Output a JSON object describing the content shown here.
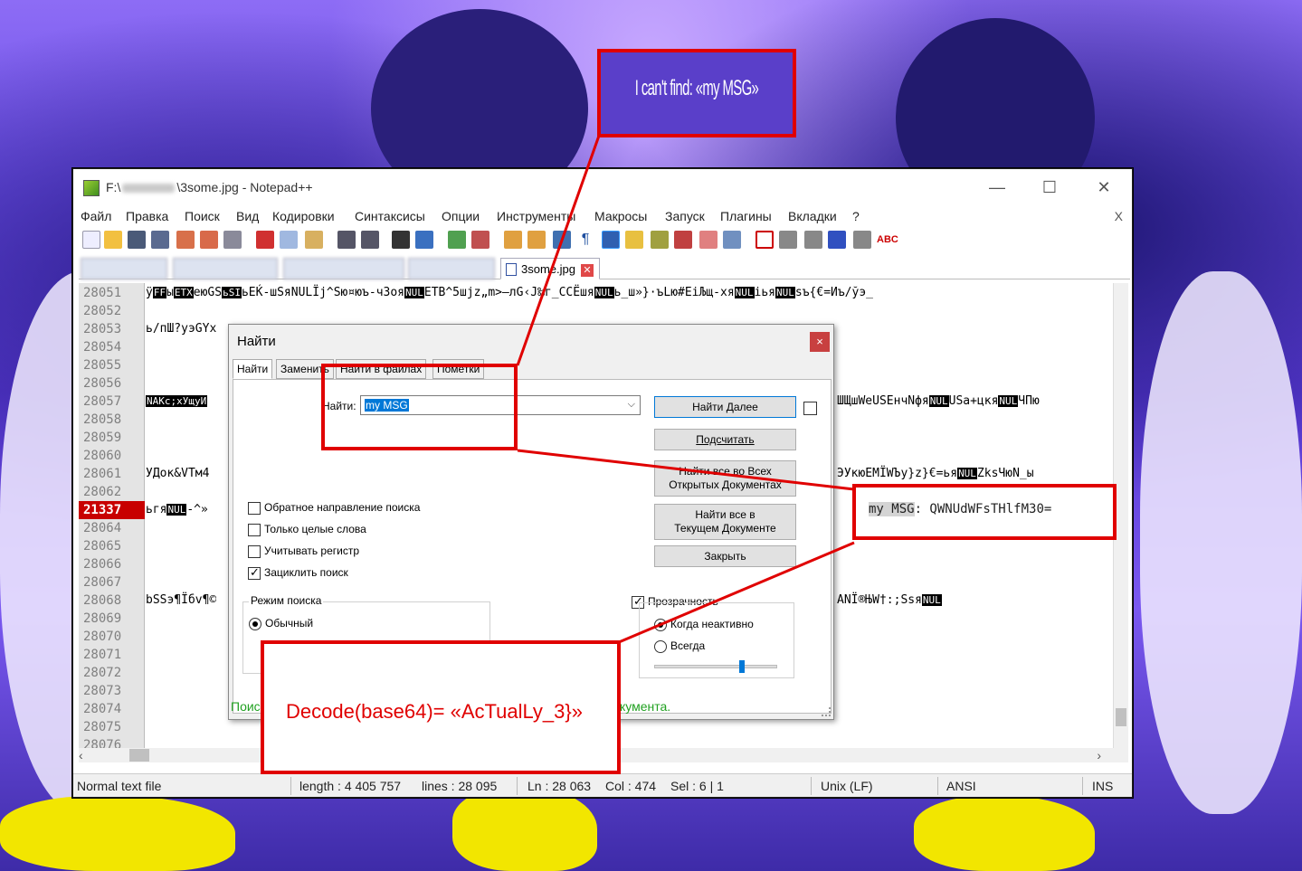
{
  "window": {
    "title_prefix": "F:\\",
    "title_suffix": "\\3some.jpg - Notepad++",
    "min": "—",
    "max": "☐",
    "close": "✕"
  },
  "menu": [
    "Файл",
    "Правка",
    "Поиск",
    "Вид",
    "Кодировки",
    "Синтаксисы",
    "Опции",
    "Инструменты",
    "Макросы",
    "Запуск",
    "Плагины",
    "Вкладки",
    "?"
  ],
  "menu_close": "X",
  "active_tab": "3some.jpg",
  "tab_close": "✕",
  "editor": {
    "line_numbers": [
      "28051",
      "28052",
      "28053",
      "28054",
      "28055",
      "28056",
      "28057",
      "28058",
      "28059",
      "28060",
      "28061",
      "28062",
      "21337",
      "28064",
      "28065",
      "28066",
      "28067",
      "28068",
      "28069",
      "28070",
      "28071",
      "28072",
      "28073",
      "28074",
      "28075",
      "28076"
    ],
    "marked_line": "21337",
    "lines": {
      "l0a": "ÿ",
      "l0b": "FF",
      "l0c": "ы",
      "l0d": "ETX",
      "l0e": "еюGS",
      "l0f": "ьSI",
      "l0g": "ьЕЌ-шSяNUL",
      "l0h": "Ïj^Sю¤юъ-чЗоя",
      "l0i": "NUL",
      "l0j": "ETB^5шjz„m>—лG‹J‰г_CCЁшя",
      "l0k": "NUL",
      "l0l": "ь_ш»}·ъLю#ЕiЉщ-хя",
      "l0m": "NUL",
      "l0n": "iья",
      "l0o": "NUL",
      "l0p": "sъ{€=Иъ/ўэ_",
      "l2": "ь/пШ?уэGYх",
      "l6a": "NAKс;хУщуИ",
      "l6b": "ШЩшWeUSЕнчNфя",
      "l6c": "NUL",
      "l6d": "USа+цкя",
      "l6e": "NUL",
      "l6f": "ЧПю",
      "l10a": "УДок&VTм4",
      "l10b": "ЭУкюEMЇWЪу}z}€=ья",
      "l10c": "NUL",
      "l10d": "ZksЧюN_ы",
      "l12a": "ьгя",
      "l12b": "NUL",
      "l12c": "-^»",
      "l17a": "bSSэ¶Ïбv¶©",
      "l17b": "ANÏ®ЊW†:;Ssя",
      "l17c": "NUL"
    }
  },
  "status": {
    "type": "Normal text file",
    "length": "length : 4 405 757",
    "lines": "lines : 28 095",
    "ln": "Ln : 28 063",
    "col": "Col : 474",
    "sel": "Sel : 6 | 1",
    "eol": "Unix (LF)",
    "enc": "ANSI",
    "ins": "INS"
  },
  "find_dialog": {
    "title": "Найти",
    "close": "×",
    "tabs": [
      "Найти",
      "Заменить",
      "Найти в файлах",
      "Пометки"
    ],
    "find_label": "Найти:",
    "find_value": "my MSG",
    "buttons": {
      "find_next": "Найти Далее",
      "count": "Подсчитать",
      "find_all_open_1": "Найти все во Всех",
      "find_all_open_2": "Открытых Документах",
      "find_all_current_1": "Найти все в",
      "find_all_current_2": "Текущем Документе",
      "close": "Закрыть"
    },
    "options": {
      "backward": "Обратное направление поиска",
      "whole_word": "Только целые слова",
      "match_case": "Учитывать регистр",
      "wrap": "Зациклить поиск"
    },
    "search_mode_label": "Режим поиска",
    "mode_normal": "Обычный",
    "transparency_label": "Прозрачность",
    "trans_inactive": "Когда неактивно",
    "trans_always": "Всегда",
    "status_left": "Поис",
    "status_right": "кумента."
  },
  "annotations": {
    "top_note": "I can't find: «my MSG»",
    "decode_note": "Decode(base64)= «AcTualLy_3}»",
    "msg_key": "my MSG",
    "msg_rest": ": QWNUdWFsTHlfM30="
  },
  "colors": {
    "accent_red": "#e00000",
    "marked_line_bg": "#c80000",
    "status_green": "#21a121"
  }
}
